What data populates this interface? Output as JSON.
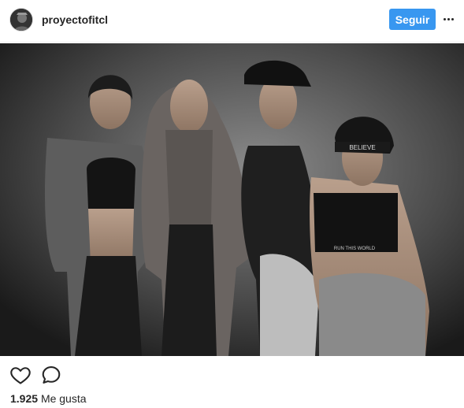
{
  "header": {
    "username": "proyectofitcl",
    "follow_label": "Seguir",
    "avatar_icon": "profile-avatar",
    "more_icon": "more-options-icon"
  },
  "photo": {
    "text_on_headband": "BELIEVE",
    "text_on_top": "RUN THIS WORLD"
  },
  "actions": {
    "like_icon": "heart-icon",
    "comment_icon": "comment-icon"
  },
  "likes": {
    "count": "1.925",
    "label": "Me gusta"
  },
  "colors": {
    "follow_bg": "#3897f0",
    "text": "#262626",
    "border": "#efefef"
  }
}
